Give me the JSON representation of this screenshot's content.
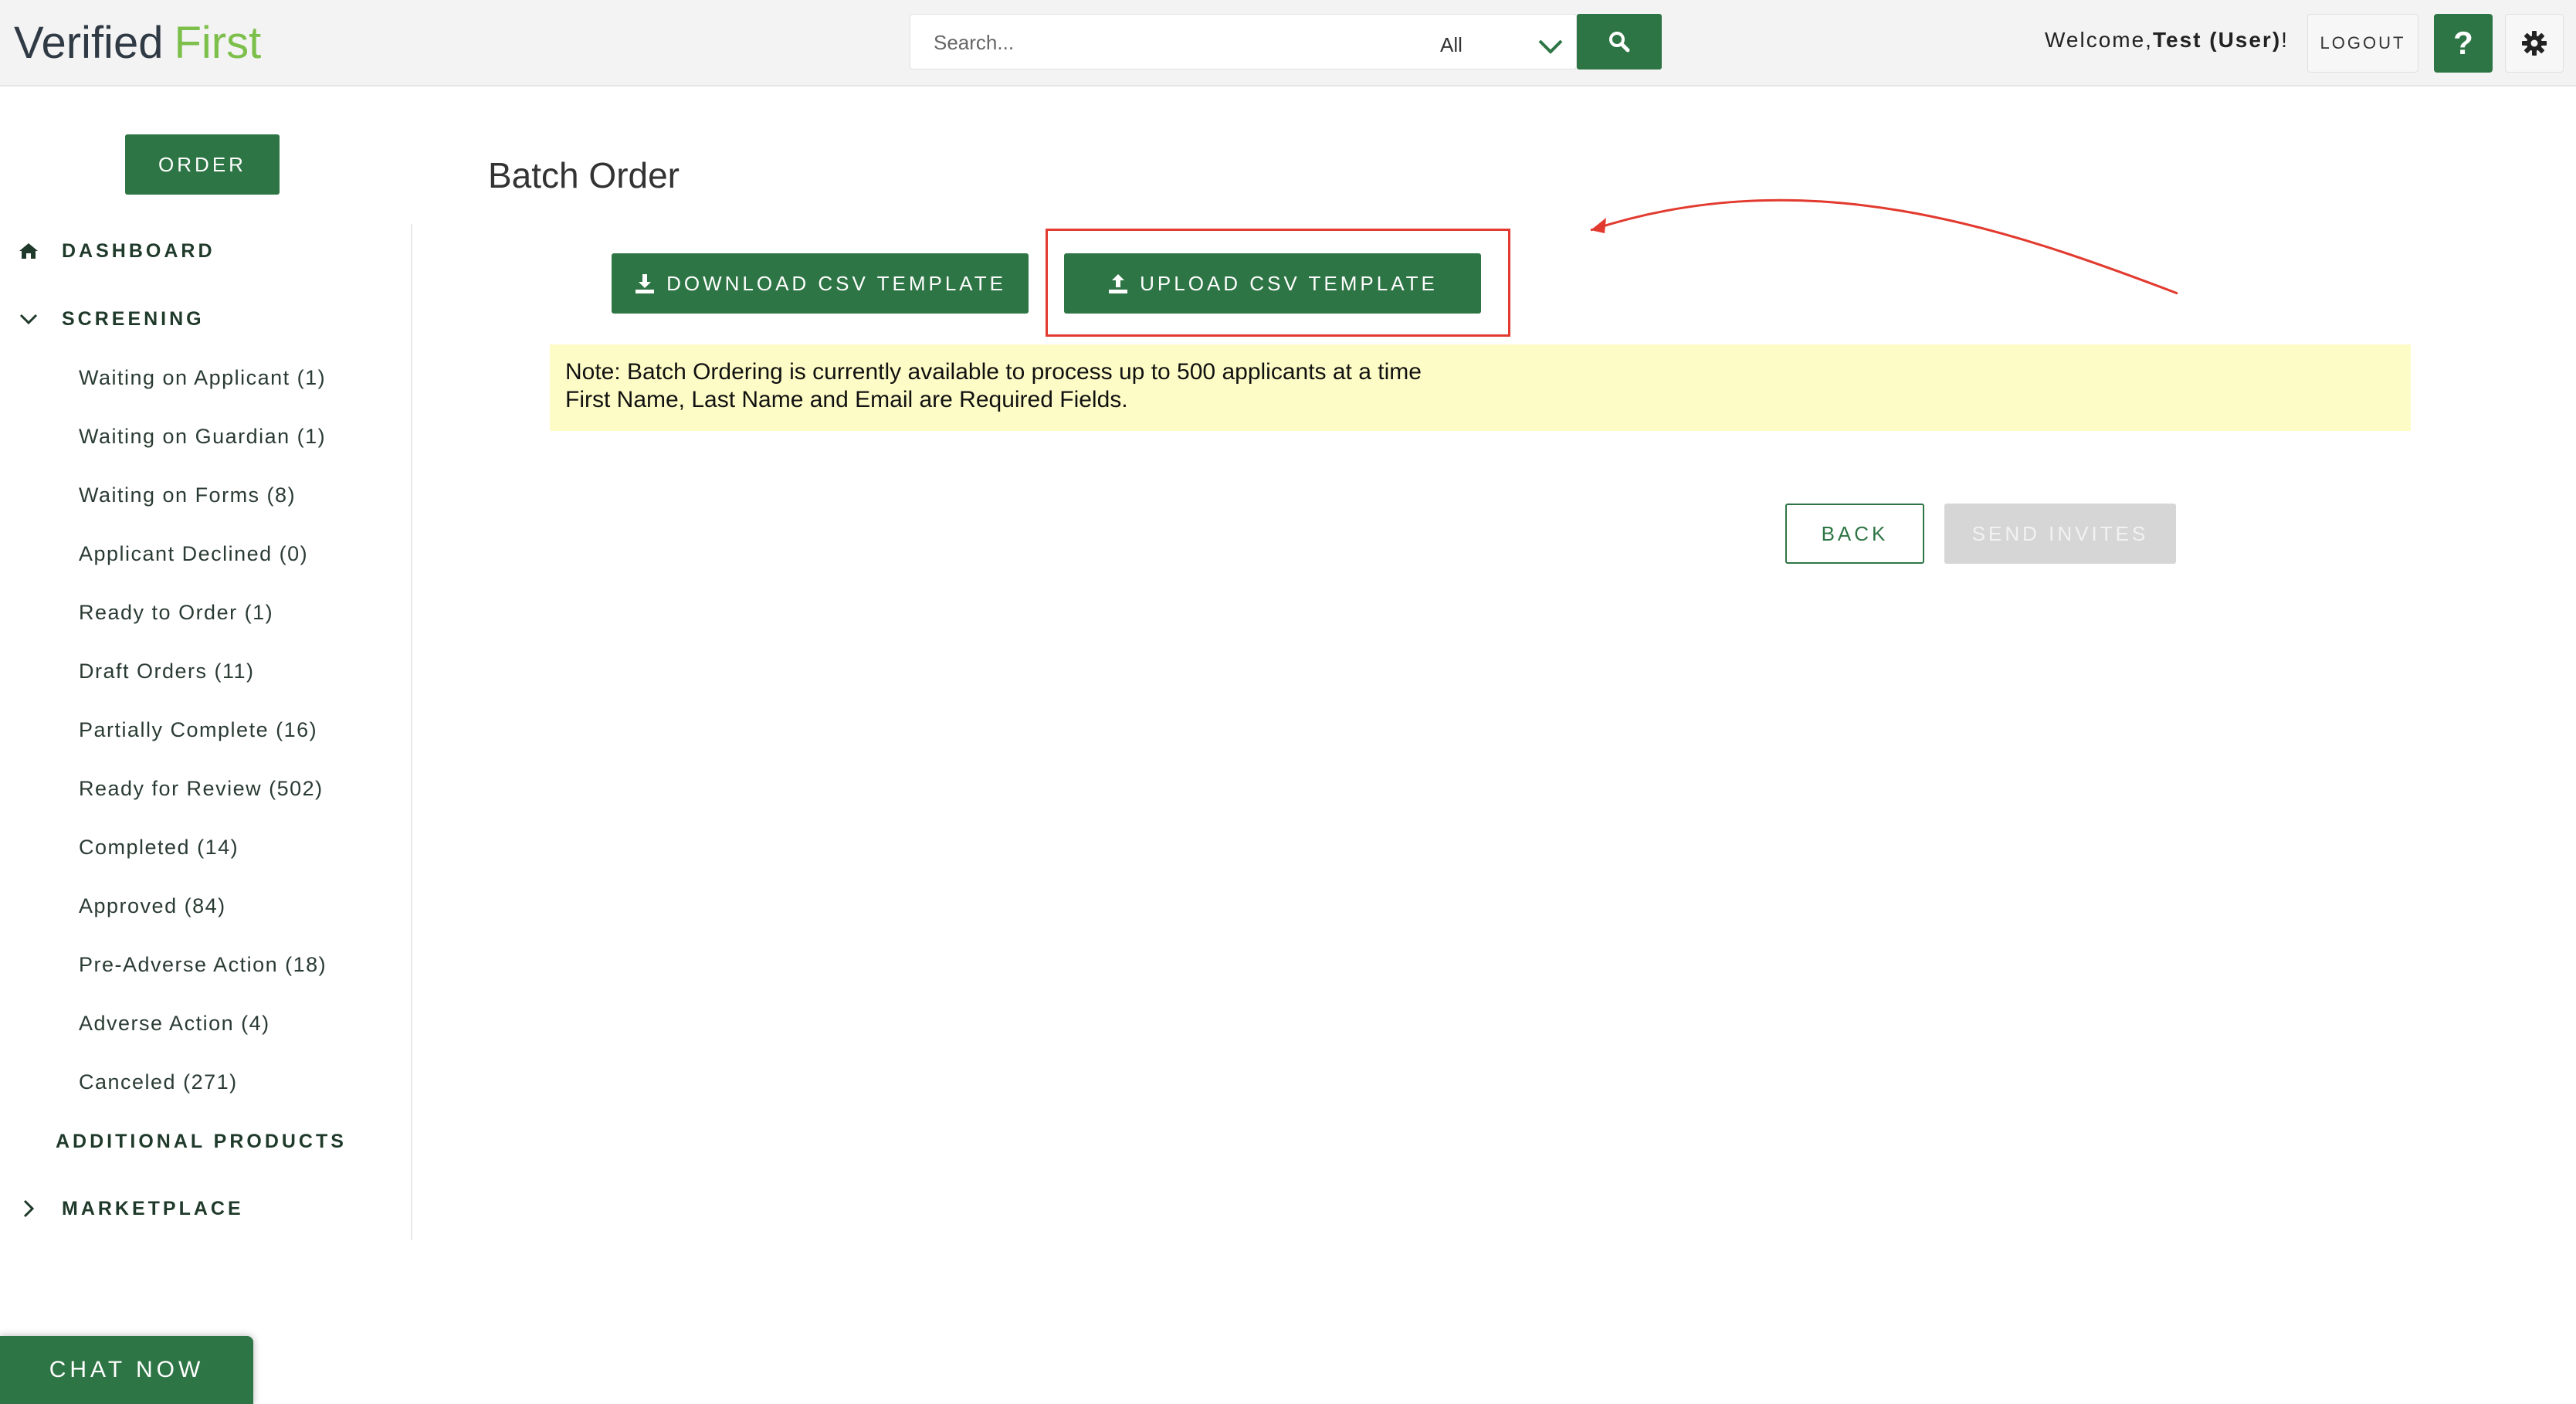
{
  "header": {
    "logo_part1": "Verified",
    "logo_part2": "First",
    "search_placeholder": "Search...",
    "search_filter": "All",
    "welcome_prefix": "Welcome,",
    "welcome_user": "Test (User)",
    "welcome_suffix": "!",
    "logout_label": "LOGOUT",
    "help_label": "?"
  },
  "sidebar": {
    "order_label": "ORDER",
    "dashboard": "DASHBOARD",
    "screening": "SCREENING",
    "screening_items": [
      "Waiting on Applicant (1)",
      "Waiting on Guardian (1)",
      "Waiting on Forms (8)",
      "Applicant Declined (0)",
      "Ready to Order (1)",
      "Draft Orders (11)",
      "Partially Complete (16)",
      "Ready for Review (502)",
      "Completed (14)",
      "Approved (84)",
      "Pre-Adverse Action (18)",
      "Adverse Action (4)",
      "Canceled (271)"
    ],
    "additional_products": "ADDITIONAL PRODUCTS",
    "marketplace": "MARKETPLACE"
  },
  "main": {
    "title": "Batch Order",
    "download_label": "DOWNLOAD CSV TEMPLATE",
    "upload_label": "UPLOAD CSV TEMPLATE",
    "note_line1": "Note: Batch Ordering is currently available to process up to 500 applicants at a time",
    "note_line2": "First Name, Last Name and Email are Required Fields.",
    "back_label": "BACK",
    "send_label": "SEND INVITES"
  },
  "chat": {
    "label": "CHAT NOW"
  },
  "colors": {
    "brand_green": "#2e7545",
    "logo_green": "#7cbf4a",
    "annotation_red": "#e23a2e",
    "note_bg": "#fdfcc6"
  },
  "icons": [
    "search-icon",
    "chevron-down-icon",
    "gear-icon",
    "home-icon",
    "chevron-right-icon",
    "download-icon",
    "upload-icon"
  ]
}
